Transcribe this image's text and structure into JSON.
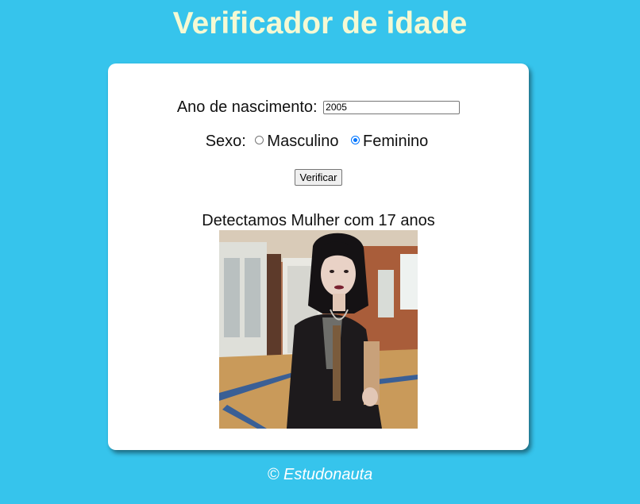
{
  "page": {
    "title": "Verificador de idade"
  },
  "form": {
    "birth_label": "Ano de nascimento:",
    "birth_value": "2005",
    "sex_label": "Sexo:",
    "options": [
      {
        "label": "Masculino",
        "checked": false
      },
      {
        "label": "Feminino",
        "checked": true
      }
    ],
    "button_label": "Verificar"
  },
  "result": {
    "text": "Detectamos Mulher com 17 anos"
  },
  "footer": {
    "text": "© Estudonauta"
  },
  "colors": {
    "background": "#36c4ec",
    "title": "#f5f9d3",
    "card": "#ffffff",
    "radio_accent": "#0075ff"
  }
}
